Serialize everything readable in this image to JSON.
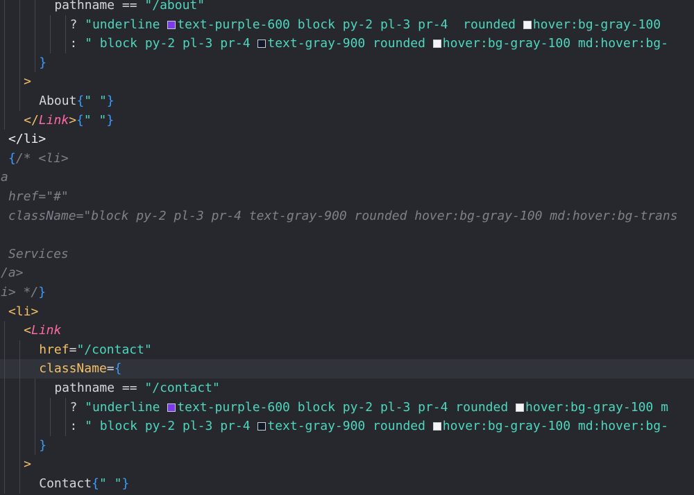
{
  "editor": {
    "lines": [
      {
        "indent": 7,
        "guides": [
          1,
          3,
          5
        ],
        "tokens": [
          {
            "t": "pathname ",
            "c": "default"
          },
          {
            "t": "==",
            "c": "op"
          },
          {
            "t": " \"/about\"",
            "c": "string"
          }
        ]
      },
      {
        "indent": 9,
        "guides": [
          1,
          3,
          5,
          7,
          9
        ],
        "tokens": [
          {
            "t": "? ",
            "c": "default"
          },
          {
            "t": "\"underline ",
            "c": "string"
          },
          {
            "swatch": "#7c3aed"
          },
          {
            "t": "text-purple-600 block py-2 pl-3 pr-4  rounded ",
            "c": "string"
          },
          {
            "swatch": "#f3f4f6"
          },
          {
            "t": "hover:bg-gray-100",
            "c": "string"
          }
        ]
      },
      {
        "indent": 9,
        "guides": [
          1,
          3,
          5,
          7,
          9
        ],
        "tokens": [
          {
            "t": ": ",
            "c": "default"
          },
          {
            "t": "\" block py-2 pl-3 pr-4 ",
            "c": "string"
          },
          {
            "swatch": "#111827"
          },
          {
            "t": "text-gray-900 rounded ",
            "c": "string"
          },
          {
            "swatch": "#f3f4f6"
          },
          {
            "t": "hover:bg-gray-100 md:hover:bg-",
            "c": "string"
          }
        ]
      },
      {
        "indent": 5,
        "guides": [
          1,
          3,
          5
        ],
        "tokens": [
          {
            "t": "}",
            "c": "bracket"
          }
        ]
      },
      {
        "indent": 3,
        "guides": [
          1,
          3
        ],
        "tokens": [
          {
            "t": ">",
            "c": "gold"
          }
        ]
      },
      {
        "indent": 5,
        "guides": [
          1,
          3
        ],
        "tokens": [
          {
            "t": "About",
            "c": "default"
          },
          {
            "t": "{",
            "c": "bracket"
          },
          {
            "t": "\" \"",
            "c": "string"
          },
          {
            "t": "}",
            "c": "bracket"
          }
        ]
      },
      {
        "indent": 3,
        "guides": [
          1
        ],
        "tokens": [
          {
            "t": "</",
            "c": "gold"
          },
          {
            "t": "Link",
            "c": "comp"
          },
          {
            "t": ">",
            "c": "gold"
          },
          {
            "t": "{",
            "c": "bracket"
          },
          {
            "t": "\" \"",
            "c": "string"
          },
          {
            "t": "}",
            "c": "bracket"
          }
        ]
      },
      {
        "indent": 1,
        "guides": [],
        "tokens": [
          {
            "t": "</",
            "c": "tag"
          },
          {
            "t": "li",
            "c": "tag"
          },
          {
            "t": ">",
            "c": "tag"
          }
        ]
      },
      {
        "indent": 1,
        "guides": [],
        "tokens": [
          {
            "t": "{",
            "c": "bracket"
          },
          {
            "t": "/* <li>",
            "c": "comment"
          }
        ]
      },
      {
        "indent": 0,
        "guides": [],
        "tokens": [
          {
            "t": "a",
            "c": "comment"
          }
        ]
      },
      {
        "indent": 1,
        "guides": [],
        "tokens": [
          {
            "t": "href=\"#\"",
            "c": "comment"
          }
        ]
      },
      {
        "indent": 1,
        "guides": [],
        "tokens": [
          {
            "t": "className=\"block py-2 pl-3 pr-4 text-gray-900 rounded hover:bg-gray-100 md:hover:bg-trans",
            "c": "comment"
          }
        ]
      },
      {
        "indent": 0,
        "guides": [],
        "tokens": []
      },
      {
        "indent": 1,
        "guides": [],
        "tokens": [
          {
            "t": "Services",
            "c": "comment"
          }
        ]
      },
      {
        "indent": 0,
        "guides": [],
        "tokens": [
          {
            "t": "/a>",
            "c": "comment"
          }
        ]
      },
      {
        "indent": 0,
        "guides": [],
        "tokens": [
          {
            "t": "i> */",
            "c": "comment"
          },
          {
            "t": "}",
            "c": "bracket"
          }
        ]
      },
      {
        "indent": 1,
        "guides": [],
        "tokens": [
          {
            "t": "<li>",
            "c": "gold"
          }
        ]
      },
      {
        "indent": 3,
        "guides": [
          1
        ],
        "tokens": [
          {
            "t": "<",
            "c": "gold"
          },
          {
            "t": "Link",
            "c": "comp"
          }
        ]
      },
      {
        "indent": 5,
        "guides": [
          1,
          3
        ],
        "tokens": [
          {
            "t": "href",
            "c": "attr"
          },
          {
            "t": "=",
            "c": "default"
          },
          {
            "t": "\"/contact\"",
            "c": "string"
          }
        ]
      },
      {
        "indent": 5,
        "guides": [
          1,
          3
        ],
        "current": true,
        "tokens": [
          {
            "t": "className",
            "c": "attr"
          },
          {
            "t": "=",
            "c": "default"
          },
          {
            "t": "{",
            "c": "bracket"
          }
        ]
      },
      {
        "indent": 7,
        "guides": [
          1,
          3,
          5
        ],
        "tokens": [
          {
            "t": "pathname ",
            "c": "default"
          },
          {
            "t": "==",
            "c": "op"
          },
          {
            "t": " \"/contact\"",
            "c": "string"
          }
        ]
      },
      {
        "indent": 9,
        "guides": [
          1,
          3,
          5,
          7,
          9
        ],
        "tokens": [
          {
            "t": "? ",
            "c": "default"
          },
          {
            "t": "\"underline ",
            "c": "string"
          },
          {
            "swatch": "#7c3aed"
          },
          {
            "t": "text-purple-600 block py-2 pl-3 pr-4 rounded ",
            "c": "string"
          },
          {
            "swatch": "#f3f4f6"
          },
          {
            "t": "hover:bg-gray-100 m",
            "c": "string"
          }
        ]
      },
      {
        "indent": 9,
        "guides": [
          1,
          3,
          5,
          7,
          9
        ],
        "tokens": [
          {
            "t": ": ",
            "c": "default"
          },
          {
            "t": "\" block py-2 pl-3 pr-4 ",
            "c": "string"
          },
          {
            "swatch": "#111827"
          },
          {
            "t": "text-gray-900 rounded ",
            "c": "string"
          },
          {
            "swatch": "#f3f4f6"
          },
          {
            "t": "hover:bg-gray-100 md:hover:bg-",
            "c": "string"
          }
        ]
      },
      {
        "indent": 5,
        "guides": [
          1,
          3,
          5
        ],
        "tokens": [
          {
            "t": "}",
            "c": "bracket"
          }
        ]
      },
      {
        "indent": 3,
        "guides": [
          1,
          3
        ],
        "tokens": [
          {
            "t": ">",
            "c": "gold"
          }
        ]
      },
      {
        "indent": 5,
        "guides": [
          1,
          3
        ],
        "tokens": [
          {
            "t": "Contact",
            "c": "default"
          },
          {
            "t": "{",
            "c": "bracket"
          },
          {
            "t": "\" \"",
            "c": "string"
          },
          {
            "t": "}",
            "c": "bracket"
          }
        ]
      }
    ]
  }
}
